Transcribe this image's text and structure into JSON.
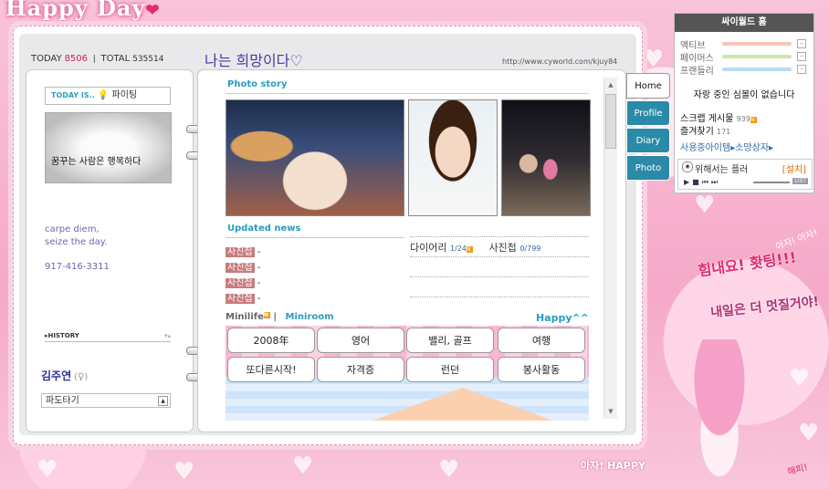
{
  "bg": {
    "title": "Happy Day",
    "title_heart": "❤"
  },
  "header": {
    "today_label": "TODAY",
    "today_count": "8506",
    "total_label": "TOTAL",
    "total_count": "535514",
    "title": "나는 희망이다♡",
    "url": "http://www.cyworld.com/kjuy84"
  },
  "profile": {
    "today_is_label": "TODAY IS..",
    "today_is_value": "파이팅",
    "photo_caption": "꿈꾸는 사람은 행복하다",
    "motto_line1": "carpe diem,",
    "motto_line2": "seize the day.",
    "phone": "917-416-3311",
    "history_label": "HISTORY",
    "name": "김주연",
    "gender": "(♀)",
    "mood": "파도타기"
  },
  "main": {
    "photo_story_title": "Photo story",
    "updated_news_title": "Updated news",
    "news_tag": "사진첩",
    "news_items": [
      "-",
      "-",
      "-",
      "-"
    ],
    "diary_label": "다이어리",
    "diary_count": "1/24",
    "album_label": "사진첩",
    "album_count": "0/799",
    "new_badge": "N",
    "minilife_label": "Minilife",
    "miniroom_label": "Miniroom",
    "happy_label": "Happy^^",
    "bubbles": [
      "2008年",
      "영어",
      "밸리, 골프",
      "여행",
      "또다른시작!",
      "자격증",
      "런던",
      "봉사활동"
    ]
  },
  "tabs": [
    "Home",
    "Profile",
    "Diary",
    "Photo"
  ],
  "cyworld": {
    "title": "싸이월드 홈",
    "stats": [
      "액티브",
      "페이머스",
      "프랜들리"
    ],
    "stat_colors": [
      "#f6c5b8",
      "#cde7a9",
      "#b9dcf0"
    ],
    "message": "자랑 중인 심볼이 없습니다",
    "scrap_label": "스크랩 게시물",
    "scrap_count": "939",
    "fav_label": "즐겨찾기",
    "fav_count": "171",
    "items_link": "사용중아이템▸소망상자▸",
    "player_text": "위해서는 플러",
    "player_setup": "[설치]",
    "player_list": "LIST"
  },
  "deco": {
    "cheer1": "힘내요! 홧팅!!!",
    "cheer2": "내일은 더 멋질거야!",
    "cheer3": "아자! 아자!",
    "cheer4": "아자! HAPPY",
    "cheer5": "해피!"
  }
}
